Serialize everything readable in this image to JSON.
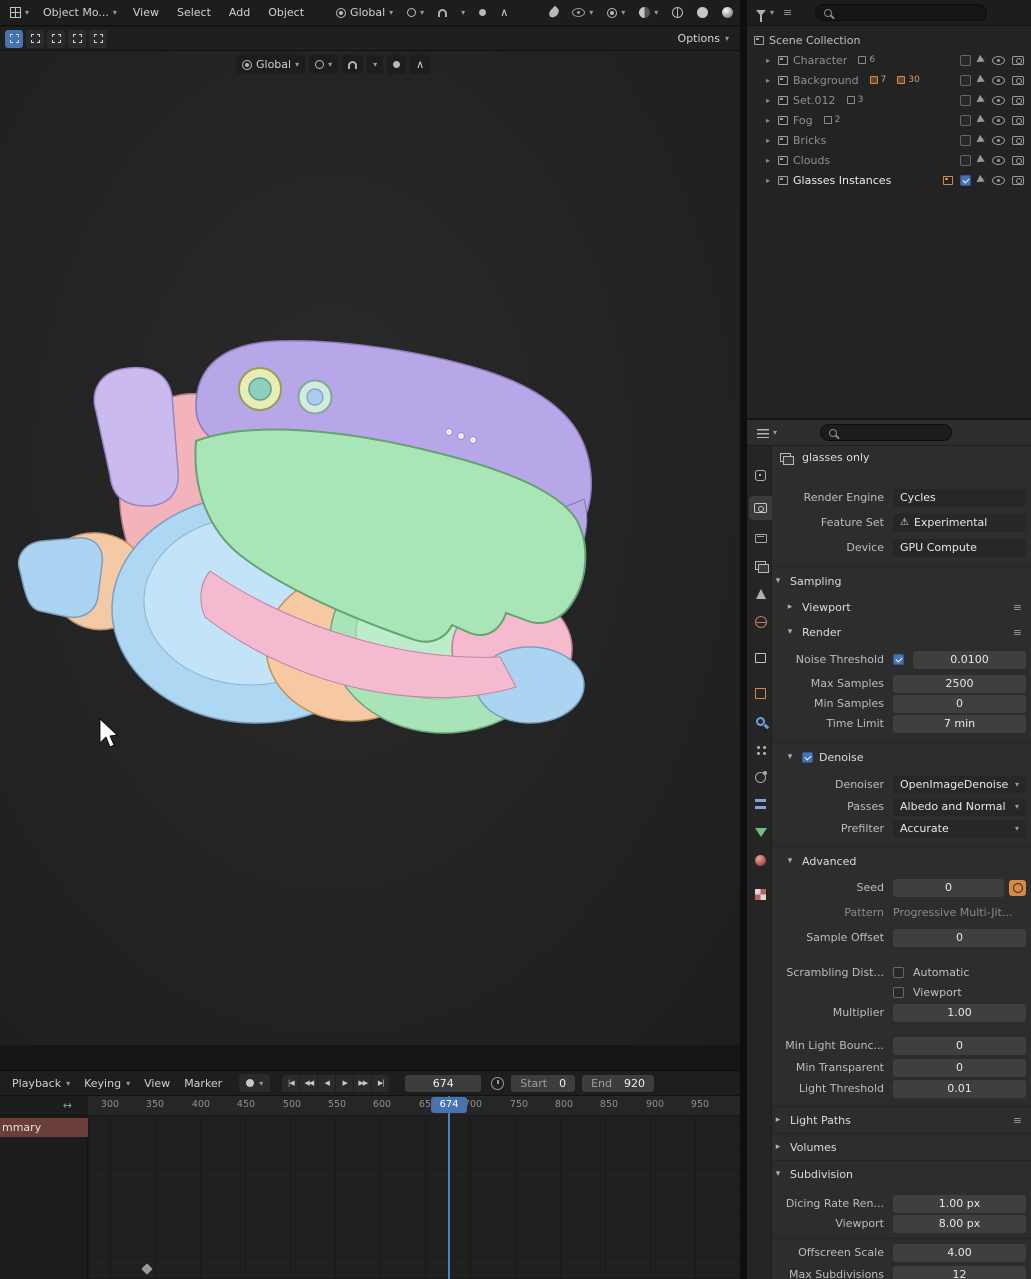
{
  "icons": {
    "caret": "▾",
    "tri_open": "▾",
    "tri_closed": "▸",
    "warning": "⚠",
    "preset_lines": "≡",
    "jump_start": "|◀",
    "prev_key": "◀◀",
    "play_back": "◀",
    "play": "▶",
    "next_key": "▶▶",
    "jump_end": "▶|",
    "expand_h": "↔",
    "falloff": "∧"
  },
  "topbar": {
    "mode_label": "Object Mo...",
    "menu_view": "View",
    "menu_select": "Select",
    "menu_add": "Add",
    "menu_object": "Object",
    "orientation": "Global",
    "options": "Options"
  },
  "viewport": {
    "orientation": "Global"
  },
  "outliner": {
    "rows": [
      {
        "label": "Scene Collection"
      },
      {
        "label": "Character",
        "badge": "6"
      },
      {
        "label": "Background",
        "badge": "7",
        "badge2": "30"
      },
      {
        "label": "Set.012",
        "badge": "3"
      },
      {
        "label": "Fog",
        "badge": "2"
      },
      {
        "label": "Bricks"
      },
      {
        "label": "Clouds"
      },
      {
        "label": "Glasses Instances"
      }
    ]
  },
  "properties": {
    "viewlayer": "glasses only",
    "render_engine": {
      "label": "Render Engine",
      "value": "Cycles"
    },
    "feature_set": {
      "label": "Feature Set",
      "value": "Experimental"
    },
    "device": {
      "label": "Device",
      "value": "GPU Compute"
    },
    "sampling": {
      "title": "Sampling"
    },
    "sampling_viewport": {
      "title": "Viewport"
    },
    "sampling_render": {
      "title": "Render"
    },
    "noise_threshold": {
      "label": "Noise Threshold",
      "value": "0.0100"
    },
    "max_samples": {
      "label": "Max Samples",
      "value": "2500"
    },
    "min_samples": {
      "label": "Min Samples",
      "value": "0"
    },
    "time_limit": {
      "label": "Time Limit",
      "value": "7 min"
    },
    "denoise": {
      "title": "Denoise"
    },
    "denoiser": {
      "label": "Denoiser",
      "value": "OpenImageDenoise"
    },
    "passes": {
      "label": "Passes",
      "value": "Albedo and Normal"
    },
    "prefilter": {
      "label": "Prefilter",
      "value": "Accurate"
    },
    "advanced": {
      "title": "Advanced"
    },
    "seed": {
      "label": "Seed",
      "value": "0"
    },
    "pattern": {
      "label": "Pattern",
      "value": "Progressive Multi-Jit..."
    },
    "sample_offset": {
      "label": "Sample Offset",
      "value": "0"
    },
    "scrambling": {
      "label": "Scrambling Dist...",
      "automatic": "Automatic",
      "viewport": "Viewport"
    },
    "multiplier": {
      "label": "Multiplier",
      "value": "1.00"
    },
    "min_light_bounces": {
      "label": "Min Light Bounc...",
      "value": "0"
    },
    "min_transparent": {
      "label": "Min Transparent",
      "value": "0"
    },
    "light_threshold": {
      "label": "Light Threshold",
      "value": "0.01"
    },
    "light_paths": {
      "title": "Light Paths"
    },
    "volumes": {
      "title": "Volumes"
    },
    "subdivision": {
      "title": "Subdivision"
    },
    "dicing_rate": {
      "label": "Dicing Rate Ren...",
      "value": "1.00 px"
    },
    "dicing_viewport": {
      "label": "Viewport",
      "value": "8.00 px"
    },
    "offscreen_scale": {
      "label": "Offscreen Scale",
      "value": "4.00"
    },
    "max_subdivisions": {
      "label": "Max Subdivisions",
      "value": "12"
    }
  },
  "timeline": {
    "menu_playback": "Playback",
    "menu_keying": "Keying",
    "menu_view": "View",
    "menu_marker": "Marker",
    "current_frame": "674",
    "start_label": "Start",
    "start_value": "0",
    "end_label": "End",
    "end_value": "920",
    "ruler": [
      "300",
      "350",
      "400",
      "450",
      "500",
      "550",
      "600",
      "650",
      "700",
      "750",
      "800",
      "850",
      "900",
      "950"
    ],
    "playhead": "674",
    "summary_channel": "mmary"
  },
  "colors": {
    "accent_blue": "#4772b3",
    "badge_orange": "#d38a4a",
    "summary_red": "#6b3f39"
  }
}
